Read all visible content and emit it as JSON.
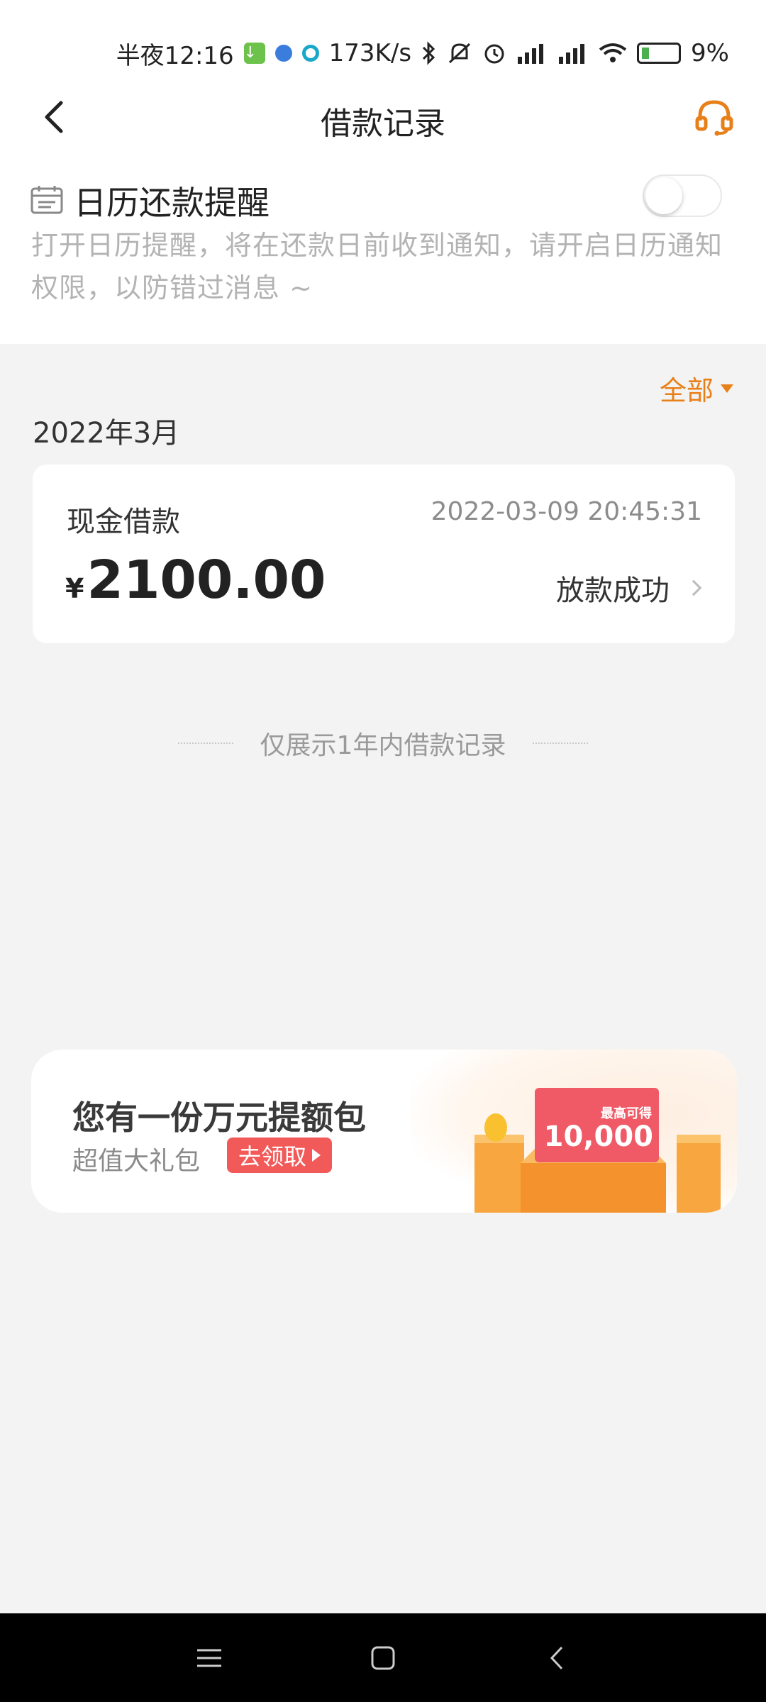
{
  "status_bar": {
    "time": "半夜12:16",
    "network_speed": "173K/s",
    "battery": "9%"
  },
  "header": {
    "title": "借款记录",
    "back_icon": "chevron-left-icon",
    "support_icon": "headset-icon",
    "accent_color": "#e8801a"
  },
  "reminder": {
    "icon": "calendar-icon",
    "title": "日历还款提醒",
    "toggle_on": false,
    "description": "打开日历提醒，将在还款日前收到通知，请开启日历通知权限，以防错过消息 ~"
  },
  "filter": {
    "label": "全部"
  },
  "records": {
    "month": "2022年3月",
    "items": [
      {
        "type": "现金借款",
        "datetime": "2022-03-09 20:45:31",
        "currency": "¥",
        "amount": "2100.00",
        "status": "放款成功"
      }
    ],
    "note": "仅展示1年内借款记录"
  },
  "promo": {
    "title": "您有一份万元提额包",
    "subtitle": "超值大礼包",
    "cta": "去领取",
    "art_label": "最高可得",
    "art_value": "10,000",
    "cta_color": "#f25a5a"
  },
  "system_nav": {
    "menu_icon": "menu-icon",
    "home_icon": "home-icon",
    "back_icon": "back-icon"
  }
}
